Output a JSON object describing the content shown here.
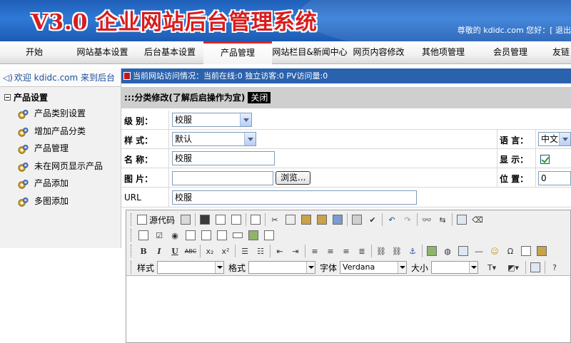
{
  "header": {
    "logo": "V3.0 企业网站后台管理系统",
    "welcome": "尊敬的 kdidc.com 您好：[ 退出"
  },
  "nav": {
    "tabs": [
      {
        "label": "开始",
        "active": false
      },
      {
        "label": "网站基本设置",
        "active": false
      },
      {
        "label": "后台基本设置",
        "active": false
      },
      {
        "label": "产品管理",
        "active": true
      },
      {
        "label": "网站栏目&新闻中心",
        "active": false
      },
      {
        "label": "网页内容修改",
        "active": false
      },
      {
        "label": "其他项管理",
        "active": false
      },
      {
        "label": "会员管理",
        "active": false
      },
      {
        "label": "友链",
        "active": false
      }
    ]
  },
  "sidebar": {
    "welcome": "欢迎 kdidc.com 来到后台",
    "group": "产品设置",
    "items": [
      "产品类别设置",
      "增加产品分类",
      "产品管理",
      "未在网页显示产品",
      "产品添加",
      "多图添加"
    ]
  },
  "status": {
    "text": "当前网站访问情况：当前在线:0 独立访客:0 PV访问量:0"
  },
  "form": {
    "title": ":::分类修改(了解后启操作为宜)",
    "close": "关闭",
    "level_label": "级 别：",
    "level_value": "校服",
    "style_label": "样 式：",
    "style_value": "默认",
    "lang_label": "语 言：",
    "lang_value": "中文",
    "name_label": "名 称：",
    "name_value": "校服",
    "show_label": "显 示：",
    "show_checked": true,
    "image_label": "图 片：",
    "image_value": "",
    "browse_label": "浏览...",
    "pos_label": "位 置：",
    "pos_value": "0",
    "url_label": "URL",
    "url_value": "校服"
  },
  "editor": {
    "source_label": "源代码",
    "style_label": "样式",
    "format_label": "格式",
    "font_label": "字体",
    "font_value": "Verdana",
    "size_label": "大小"
  }
}
